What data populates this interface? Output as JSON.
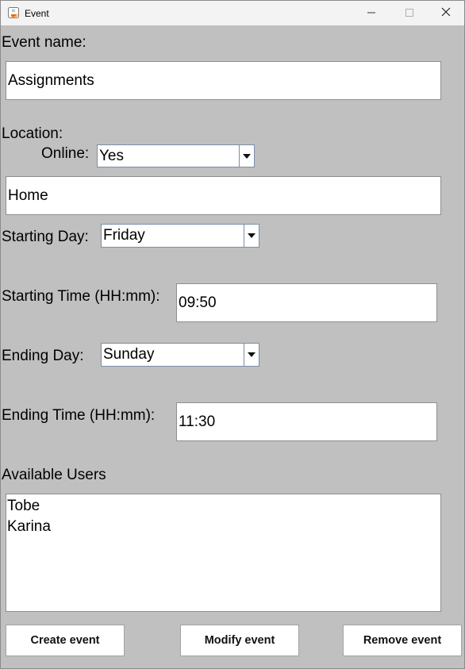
{
  "window": {
    "title": "Event",
    "icon": "java-icon",
    "controls": [
      "minimize-icon",
      "maximize-icon",
      "close-icon"
    ]
  },
  "form": {
    "event_name_label": "Event name:",
    "event_name_value": "Assignments",
    "location_label": "Location:",
    "online_label": "Online:",
    "online_value": "Yes",
    "location_value": "Home",
    "starting_day_label": "Starting Day:",
    "starting_day_value": "Friday",
    "starting_time_label": "Starting Time (HH:mm):",
    "starting_time_value": "09:50",
    "ending_day_label": "Ending Day:",
    "ending_day_value": "Sunday",
    "ending_time_label": "Ending Time (HH:mm):",
    "ending_time_value": "11:30",
    "available_users_label": "Available Users",
    "available_users": [
      "Tobe",
      "Karina"
    ]
  },
  "buttons": {
    "create": "Create event",
    "modify": "Modify event",
    "remove": "Remove event"
  }
}
